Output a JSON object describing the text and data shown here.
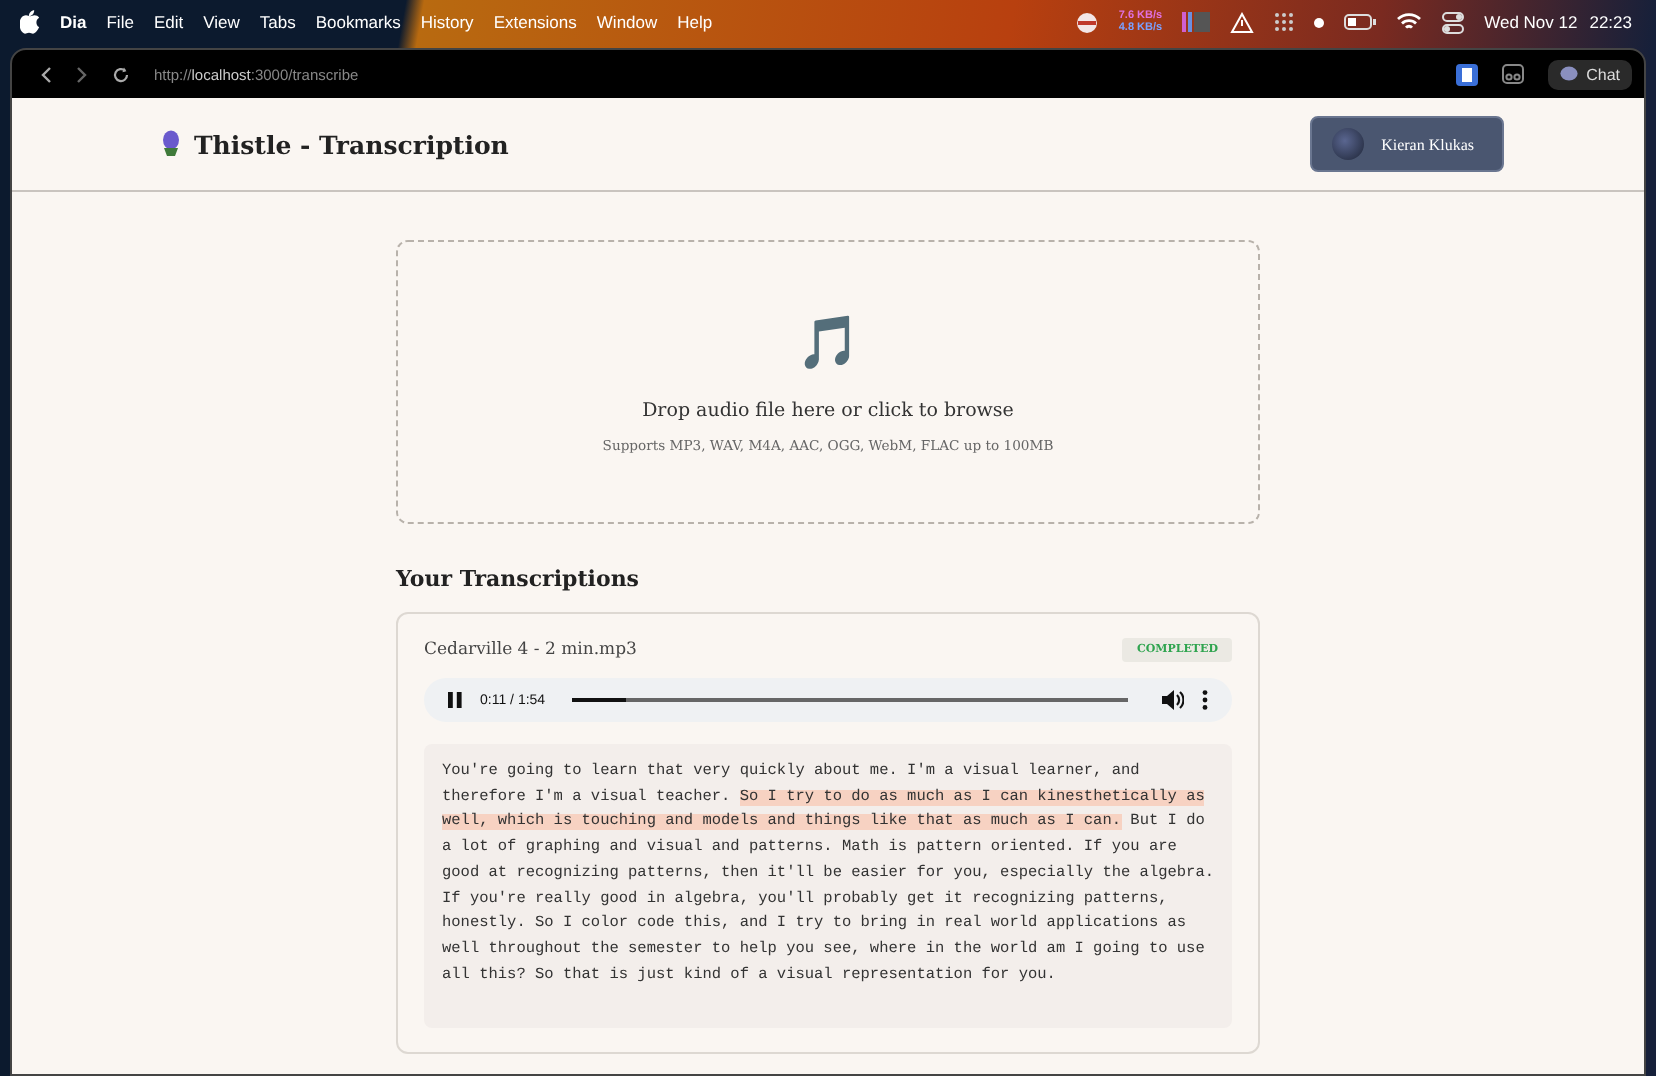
{
  "menu_bar": {
    "app_name": "Dia",
    "menus": [
      "File",
      "Edit",
      "View",
      "Tabs",
      "Bookmarks",
      "History",
      "Extensions",
      "Window",
      "Help"
    ],
    "upload_speed": "7.6 KB/s",
    "download_speed": "4.8 KB/s",
    "date": "Wed Nov 12",
    "time": "22:23"
  },
  "browser": {
    "url_scheme": "http://",
    "url_host": "localhost",
    "url_path": ":3000/transcribe",
    "chat_button": "Chat"
  },
  "header": {
    "title": "Thistle - Transcription",
    "user_name": "Kieran Klukas"
  },
  "upload": {
    "icon": "🎵",
    "prompt": "Drop audio file here or click to browse",
    "hint": "Supports MP3, WAV, M4A, AAC, OGG, WebM, FLAC up to 100MB"
  },
  "transcriptions": {
    "heading": "Your Transcriptions",
    "items": [
      {
        "file_name": "Cedarville 4 - 2 min.mp3",
        "status": "COMPLETED",
        "player": {
          "playing": true,
          "time": "0:11 / 1:54",
          "level": 0.1
        },
        "segments": [
          {
            "text": "You're going to learn that very quickly about me. I'm a visual learner, and therefore I'm a visual teacher.",
            "highlighted": false
          },
          {
            "text": "So I try to do as much as I can kinesthetically as well, which is touching and models and things like that as much as I can.",
            "highlighted": true
          },
          {
            "text": "But I do a lot of graphing and visual and patterns. Math is pattern oriented. If you are good at recognizing patterns, then it'll be easier for you, especially the algebra. If you're really good in algebra, you'll probably get it recognizing patterns, honestly. So I color code this, and I try to bring in real world applications as well throughout the semester to help you see, where in the world am I going to use all this? So that is just kind of a visual representation for you.",
            "highlighted": false
          }
        ]
      }
    ]
  }
}
